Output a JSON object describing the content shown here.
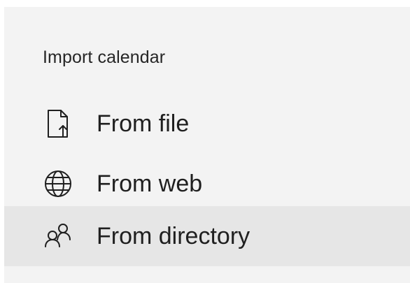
{
  "panel": {
    "title": "Import calendar",
    "items": [
      {
        "label": "From file",
        "icon": "file-import-icon",
        "selected": false
      },
      {
        "label": "From web",
        "icon": "globe-icon",
        "selected": false
      },
      {
        "label": "From directory",
        "icon": "people-icon",
        "selected": true
      }
    ]
  },
  "colors": {
    "panel_background": "#f3f3f3",
    "selected_background": "#e6e6e6",
    "text": "#1f1f1f"
  }
}
